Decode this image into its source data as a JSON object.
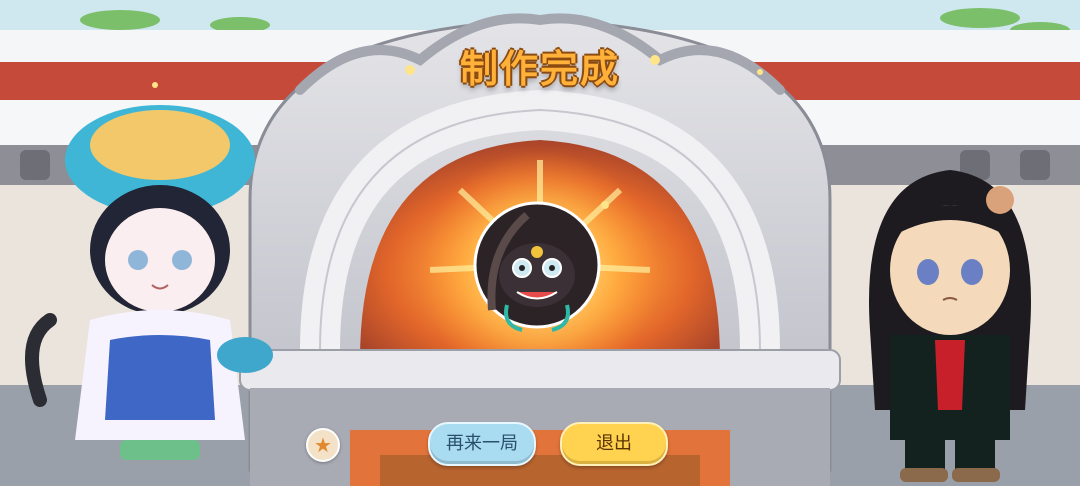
{
  "banner": {
    "title": "制作完成"
  },
  "buttons": {
    "replay_label": "再来一局",
    "exit_label": "退出"
  },
  "icons": {
    "favorite": "star-icon",
    "result_item": "lion-dance-mask-icon"
  },
  "colors": {
    "title": "#ffb13a",
    "replay_button": "#a9dcf0",
    "exit_button": "#ffd24f",
    "fire": "#ff8a2a"
  }
}
